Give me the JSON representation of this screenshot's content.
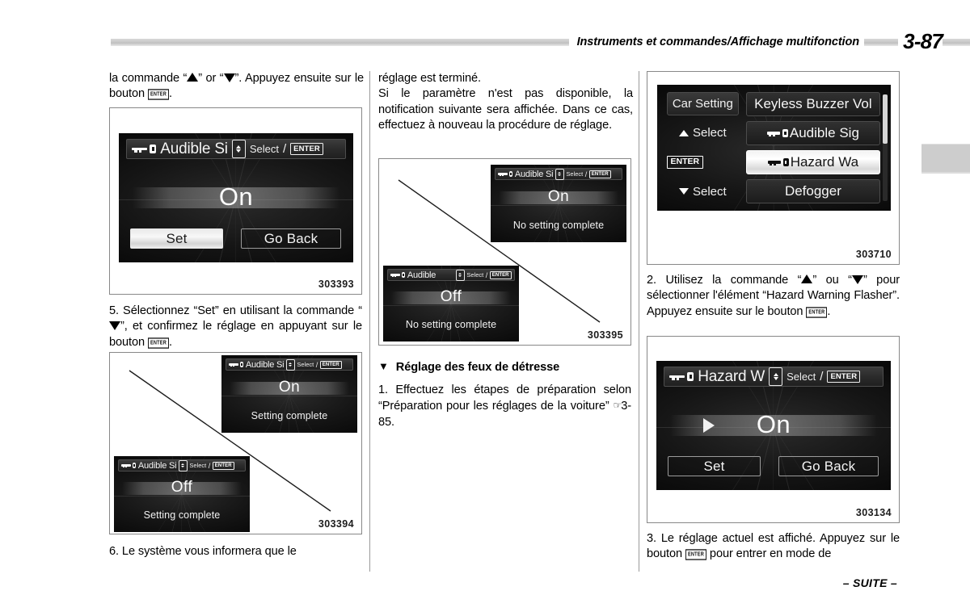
{
  "header": {
    "title": "Instruments et commandes/Affichage multifonction",
    "page_number": "3-87",
    "rule_color": "#c9c9c9"
  },
  "footer": {
    "continued": "– SUITE –"
  },
  "column1": {
    "para_top": "la commande “▲” or “▼”. Appuyez ensuite sur le bouton ENTER.",
    "para_top_part1": "la commande “",
    "para_top_part2": "” or “",
    "para_top_part3": "”. Appuyez ensuite sur le bouton ",
    "enter_label": "ENTER",
    "para_top_end": ".",
    "step5_part1": "5. Sélectionnez “Set” en utilisant la commande “",
    "step5_part2": "”, et confirmez le réglage en appuyant sur le bouton ",
    "step5_end": ".",
    "step6": "6. Le système vous informera que le",
    "figure1": {
      "number": "303393",
      "screen": {
        "header_title": "Audible Si",
        "select_label": "Select",
        "slash": "/",
        "enter_label": "ENTER",
        "value": "On",
        "button_set": "Set",
        "button_go_back": "Go Back",
        "set_highlighted": true
      }
    },
    "figure2": {
      "number": "303394",
      "screen_top": {
        "header_title": "Audible Si",
        "select_label": "Select",
        "slash": "/",
        "enter_label": "ENTER",
        "value": "On",
        "caption": "Setting complete"
      },
      "screen_bottom": {
        "header_title": "Audible Si",
        "select_label": "Select",
        "slash": "/",
        "enter_label": "ENTER",
        "value": "Off",
        "caption": "Setting complete"
      }
    }
  },
  "column2": {
    "para1": "réglage est terminé.",
    "para2": "Si le paramètre n'est pas disponible, la notification suivante sera affichée. Dans ce cas, effectuez à nouveau la procédure de réglage.",
    "heading": "Réglage des feux de détresse",
    "heading_marker": "▼",
    "step1_part1": "1. Effectuez les étapes de préparation selon “Préparation pour les réglages de la voiture” ",
    "step1_ref_icon": "☞",
    "step1_ref": "3-85.",
    "figure3": {
      "number": "303395",
      "screen_top": {
        "header_title": "Audible Si",
        "select_label": "Select",
        "slash": "/",
        "enter_label": "ENTER",
        "value": "On",
        "caption": "No setting complete"
      },
      "screen_bottom": {
        "header_title": "Audible",
        "select_label": "Select",
        "slash": "/",
        "enter_label": "ENTER",
        "value": "Off",
        "caption": "No setting complete"
      }
    }
  },
  "column3": {
    "figure4": {
      "number": "303710",
      "screen": {
        "left_items": [
          {
            "label": "Car Setting",
            "icon": "none",
            "boxed": true
          },
          {
            "label": "Select",
            "icon": "triangle-up",
            "boxed": false
          },
          {
            "label": "ENTER",
            "icon": "enter-box",
            "boxed": false
          },
          {
            "label": "Select",
            "icon": "triangle-down",
            "boxed": false
          }
        ],
        "menu_items": [
          {
            "label": "Keyless Buzzer Vol",
            "key_icon": false,
            "selected": false
          },
          {
            "label": "Audible Sig",
            "key_icon": true,
            "selected": false
          },
          {
            "label": "Hazard Wa",
            "key_icon": true,
            "selected": true
          },
          {
            "label": "Defogger",
            "key_icon": false,
            "selected": false
          }
        ]
      }
    },
    "step2_part1": "2. Utilisez la commande “",
    "step2_part2": "” ou “",
    "step2_part3": "” pour sélectionner l'élément “Hazard Warning Flasher”. Appuyez ensuite sur le bouton ",
    "step2_end": ".",
    "figure5": {
      "number": "303134",
      "screen": {
        "header_title": "Hazard W",
        "select_label": "Select",
        "slash": "/",
        "enter_label": "ENTER",
        "value": "On",
        "has_play_arrow": true,
        "button_set": "Set",
        "button_go_back": "Go Back",
        "set_highlighted": false
      }
    },
    "step3_part1": "3. Le réglage actuel est affiché. Appuyez sur le bouton ",
    "step3_part2": " pour entrer en mode de"
  }
}
